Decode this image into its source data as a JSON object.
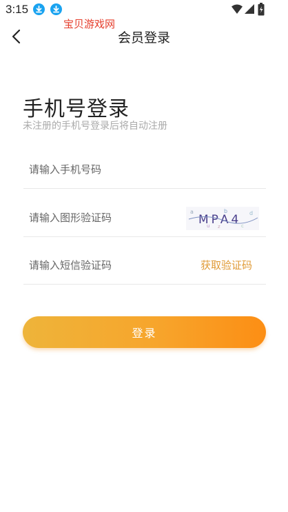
{
  "status_bar": {
    "time": "3:15",
    "icons": [
      "download-icon",
      "download-icon",
      "wifi-icon",
      "signal-icon",
      "battery-icon"
    ]
  },
  "header": {
    "title": "会员登录",
    "back_icon": "back-arrow-icon"
  },
  "login": {
    "heading": "手机号登录",
    "subheading": "未注册的手机号登录后将自动注册"
  },
  "form": {
    "phone_placeholder": "请输入手机号码",
    "captcha_placeholder": "请输入图形验证码",
    "captcha_text": "MPA4",
    "sms_placeholder": "请输入短信验证码",
    "sms_button_label": "获取验证码",
    "submit_label": "登录"
  },
  "watermark": "宝贝游戏网",
  "colors": {
    "accent_orange": "#fc8e14",
    "accent_yellow": "#eeb43a",
    "sms_link": "#e09a35",
    "watermark_red": "#e53c2a",
    "download_blue": "#1aa3f0"
  }
}
